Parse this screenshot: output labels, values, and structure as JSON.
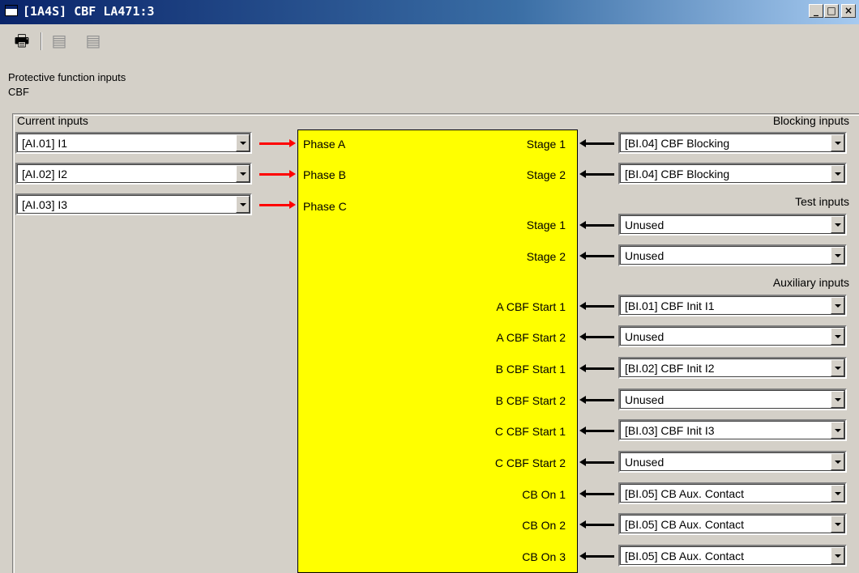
{
  "window": {
    "title": "[1A4S] CBF LA471:3",
    "minimize": "_",
    "maximize": "□",
    "close": "×"
  },
  "toolbar": {
    "icons": [
      "printer-icon",
      "export-icon",
      "import-icon"
    ]
  },
  "header": {
    "line1": "Protective function inputs",
    "line2": "CBF"
  },
  "sections": {
    "current": "Current inputs",
    "blocking": "Blocking inputs",
    "test": "Test inputs",
    "auxiliary": "Auxiliary inputs"
  },
  "current_inputs": [
    {
      "value": "[AI.01]  I1",
      "pin": "Phase A"
    },
    {
      "value": "[AI.02]  I2",
      "pin": "Phase B"
    },
    {
      "value": "[AI.03]  I3",
      "pin": "Phase C"
    }
  ],
  "right_inputs": [
    {
      "pin": "Stage 1",
      "value": "[BI.04]  CBF Blocking"
    },
    {
      "pin": "Stage 2",
      "value": "[BI.04]  CBF Blocking"
    },
    {
      "pin": "Stage 1",
      "value": "Unused"
    },
    {
      "pin": "Stage 2",
      "value": "Unused"
    },
    {
      "pin": "A CBF Start 1",
      "value": "[BI.01]  CBF Init I1"
    },
    {
      "pin": "A CBF Start 2",
      "value": "Unused"
    },
    {
      "pin": "B CBF Start 1",
      "value": "[BI.02]  CBF Init I2"
    },
    {
      "pin": "B CBF Start 2",
      "value": "Unused"
    },
    {
      "pin": "C CBF Start 1",
      "value": "[BI.03]  CBF Init I3"
    },
    {
      "pin": "C CBF Start 2",
      "value": "Unused"
    },
    {
      "pin": "CB On 1",
      "value": "[BI.05]  CB Aux. Contact"
    },
    {
      "pin": "CB On 2",
      "value": "[BI.05]  CB Aux. Contact"
    },
    {
      "pin": "CB On 3",
      "value": "[BI.05]  CB Aux. Contact"
    }
  ],
  "colors": {
    "block": "#ffff00",
    "current_arrow": "#ff0000",
    "binary_arrow": "#000000",
    "title_bar": "#0a246a"
  }
}
